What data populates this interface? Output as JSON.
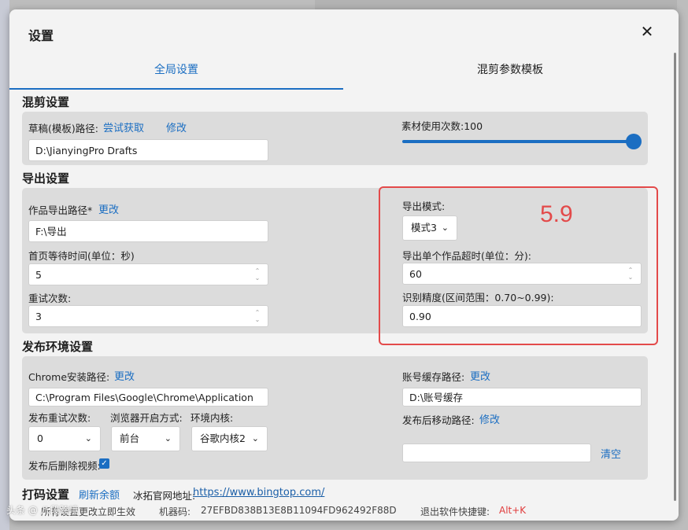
{
  "dialog": {
    "title": "设置"
  },
  "tabs": [
    {
      "label": "全局设置",
      "active": true
    },
    {
      "label": "混剪参数模板",
      "active": false
    }
  ],
  "mix": {
    "title": "混剪设置",
    "draft_label": "草稿(模板)路径:",
    "try_get": "尝试获取",
    "modify": "修改",
    "draft_path": "D:\\JianyingPro Drafts",
    "material_label": "素材使用次数:100",
    "material_count": 100
  },
  "export": {
    "title": "导出设置",
    "path_label": "作品导出路径*",
    "change": "更改",
    "path": "F:\\导出",
    "wait_label": "首页等待时间(单位：秒)",
    "wait_value": "5",
    "retry_label": "重试次数:",
    "retry_value": "3",
    "mode_label": "导出模式:",
    "mode_value": "模式3",
    "timeout_label": "导出单个作品超时(单位：分):",
    "timeout_value": "60",
    "precision_label": "识别精度(区间范围：0.70~0.99):",
    "precision_value": "0.90",
    "annotation": "5.9"
  },
  "publish": {
    "title": "发布环境设置",
    "chrome_label": "Chrome安装路径:",
    "chrome_change": "更改",
    "chrome_path": "C:\\Program Files\\Google\\Chrome\\Application",
    "retry_label": "发布重试次数:",
    "retry_value": "0",
    "browser_label": "浏览器开启方式:",
    "browser_value": "前台",
    "kernel_label": "环境内核:",
    "kernel_value": "谷歌内核2",
    "delete_label": "发布后删除视频:",
    "account_label": "账号缓存路径:",
    "account_change": "更改",
    "account_path": "D:\\账号缓存",
    "move_label": "发布后移动路径:",
    "move_modify": "修改",
    "move_path": "",
    "clear": "清空"
  },
  "captcha": {
    "title": "打码设置",
    "refresh": "刷新余额",
    "site_label": "冰拓官网地址:",
    "site_url": "https://www.bingtop.com/"
  },
  "footer": {
    "note": "所有设置更改立即生效",
    "machine_code_label": "机器码:",
    "machine_code": "27EFBD838B13E8B11094FD962492F88D",
    "exit_label": "退出软件快捷键:",
    "exit_key": "Alt+K"
  },
  "watermark": "头条 @ 八段跨境",
  "colors": {
    "accent": "#1b6ec2",
    "annotation": "#e34a4a"
  }
}
